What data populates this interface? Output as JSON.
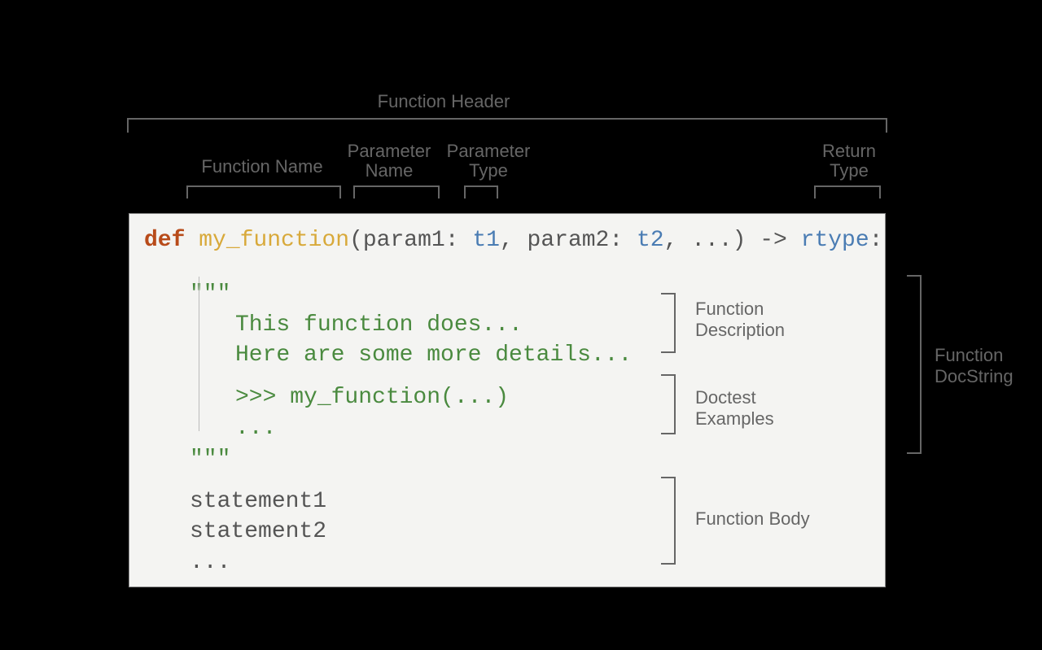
{
  "labels": {
    "function_header": "Function Header",
    "function_name": "Function Name",
    "parameter_name_l1": "Parameter",
    "parameter_name_l2": "Name",
    "parameter_type_l1": "Parameter",
    "parameter_type_l2": "Type",
    "return_type_l1": "Return",
    "return_type_l2": "Type",
    "function_description_l1": "Function",
    "function_description_l2": "Description",
    "doctest_l1": "Doctest",
    "doctest_l2": "Examples",
    "function_body": "Function Body",
    "function_docstring_l1": "Function",
    "function_docstring_l2": "DocString"
  },
  "code": {
    "def_kw": "def ",
    "func_name": "my_function",
    "open_paren": "(",
    "p1_name": "param1",
    "colon_sp": ": ",
    "p1_type": "t1",
    "comma_sp": ", ",
    "p2_name": "param2",
    "p2_type": "t2",
    "ellipsis": "...",
    "close_paren": ")",
    "arrow": " -> ",
    "rtype": "rtype",
    "end_colon": ":",
    "triple_quote": "\"\"\"",
    "desc_l1": "This function does...",
    "desc_l2": "Here are some more details...",
    "doctest_l1": ">>> my_function(...)",
    "doctest_l2": "...",
    "stmt1": "statement1",
    "stmt2": "statement2",
    "stmt3": "..."
  }
}
